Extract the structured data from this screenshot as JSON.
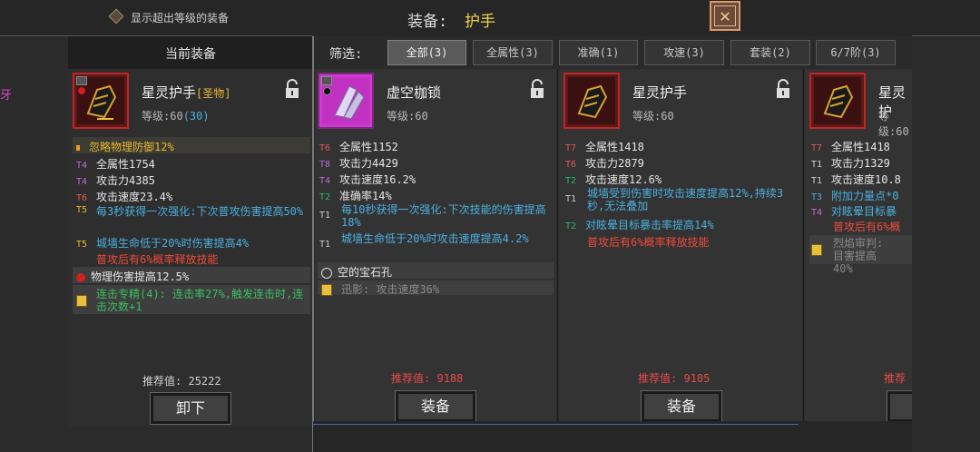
{
  "header": {
    "toggle_label": "显示超出等级的装备",
    "title_prefix": "装备:",
    "title_suffix": "护手",
    "close_icon": "✕"
  },
  "edge_fragment": "牙",
  "current": {
    "header": "当前装备",
    "name": "星灵护手",
    "tag": "[圣物]",
    "level_prefix": "等级:60",
    "level_extra": "(30)",
    "affixes": [
      {
        "tier": "",
        "text": "忽略物理防御12%"
      },
      {
        "tier": "T4",
        "text": "全属性1754"
      },
      {
        "tier": "T4",
        "text": "攻击力4385"
      },
      {
        "tier": "T6",
        "text": "攻击速度23.4%"
      },
      {
        "tier": "T5",
        "text": "每3秒获得一次强化:下次普攻伤害提高50%"
      },
      {
        "tier": "T5",
        "text": "城墙生命低于20%时伤害提高4%"
      },
      {
        "tier": "",
        "text": "普攻后有6%概率释放技能"
      }
    ],
    "gem_text": "物理伤害提高12.5%",
    "set_text": "连击专精(4): 连击率27%,触发连击时,连击次数+1",
    "rec_label": "推荐值:",
    "rec_value": "25222",
    "button": "卸下"
  },
  "filter": {
    "label": "筛选:",
    "tabs": [
      "全部(3)",
      "全属性(3)",
      "准确(1)",
      "攻速(3)",
      "套装(2)",
      "6/7阶(3)"
    ]
  },
  "candidates": [
    {
      "name": "虚空枷锁",
      "level": "等级:60",
      "affixes": [
        {
          "tier": "T6",
          "text": "全属性1152"
        },
        {
          "tier": "T8",
          "text": "攻击力4429"
        },
        {
          "tier": "T4",
          "text": "攻击速度16.2%"
        },
        {
          "tier": "T2",
          "text": "准确率14%"
        },
        {
          "tier": "T1",
          "text": "每10秒获得一次强化:下次技能的伤害提高18%"
        },
        {
          "tier": "T1",
          "text": "城墙生命低于20%时攻击速度提高4.2%"
        }
      ],
      "socket_text": "空的宝石孔",
      "set_text": "迅影: 攻击速度36%",
      "rec_label": "推荐值:",
      "rec_value": "9188",
      "button": "装备"
    },
    {
      "name": "星灵护手",
      "level": "等级:60",
      "affixes": [
        {
          "tier": "T7",
          "text": "全属性1418"
        },
        {
          "tier": "T6",
          "text": "攻击力2879"
        },
        {
          "tier": "T2",
          "text": "攻击速度12.6%"
        },
        {
          "tier": "T1",
          "text": "城墙受到伤害时攻击速度提高12%,持续3秒,无法叠加"
        },
        {
          "tier": "T2",
          "text": "对眩晕目标暴击率提高14%"
        },
        {
          "tier": "",
          "text": "普攻后有6%概率释放技能"
        }
      ],
      "rec_label": "推荐值:",
      "rec_value": "9105",
      "button": "装备"
    },
    {
      "name": "星灵护",
      "level": "等级:60",
      "affixes": [
        {
          "tier": "T7",
          "text": "全属性1418"
        },
        {
          "tier": "T1",
          "text": "攻击力1329"
        },
        {
          "tier": "T1",
          "text": "攻击速度10.8"
        },
        {
          "tier": "T3",
          "text": "附加力量点*0"
        },
        {
          "tier": "T4",
          "text": "对眩晕目标暴"
        },
        {
          "tier": "",
          "text": "普攻后有6%概"
        }
      ],
      "set_text": "烈焰审判: 目害提高40%",
      "rec_label": "推荐"
    }
  ]
}
